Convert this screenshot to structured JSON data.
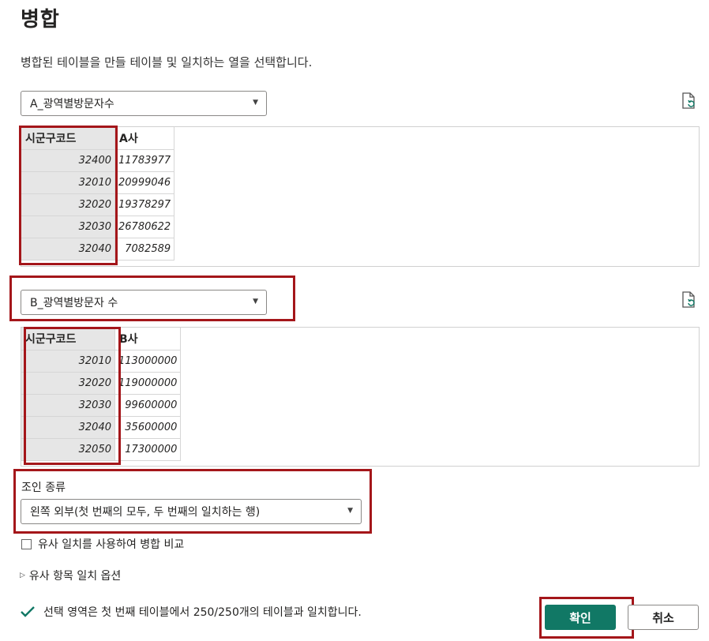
{
  "dialog": {
    "title": "병합",
    "subtitle": "병합된 테이블을 만들 테이블 및 일치하는 열을 선택합니다."
  },
  "table1": {
    "selected": "A_광역별방문자수",
    "columns": [
      "시군구코드",
      "A사"
    ],
    "rows": [
      [
        "32400",
        "11783977"
      ],
      [
        "32010",
        "20999046"
      ],
      [
        "32020",
        "19378297"
      ],
      [
        "32030",
        "26780622"
      ],
      [
        "32040",
        "7082589"
      ]
    ]
  },
  "table2": {
    "selected": "B_광역별방문자 수",
    "columns": [
      "시군구코드",
      "B사"
    ],
    "rows": [
      [
        "32010",
        "113000000"
      ],
      [
        "32020",
        "119000000"
      ],
      [
        "32030",
        "99600000"
      ],
      [
        "32040",
        "35600000"
      ],
      [
        "32050",
        "17300000"
      ]
    ]
  },
  "join": {
    "label": "조인 종류",
    "selected": "왼쪽 외부(첫 번째의 모두, 두 번째의 일치하는 행)"
  },
  "fuzzy": {
    "checkbox_label": "유사 일치를 사용하여 병합 비교",
    "options_label": "유사 항목 일치 옵션"
  },
  "status": {
    "message": "선택 영역은 첫 번째 테이블에서 250/250개의 테이블과 일치합니다."
  },
  "buttons": {
    "ok": "확인",
    "cancel": "취소"
  },
  "colors": {
    "primary": "#117865",
    "highlight": "#a4161a",
    "check": "#117865"
  },
  "icons": {
    "refresh": "refresh-doc-icon",
    "dropdown": "caret-down-icon",
    "expand": "triangle-right-icon",
    "status": "checkmark-icon"
  }
}
